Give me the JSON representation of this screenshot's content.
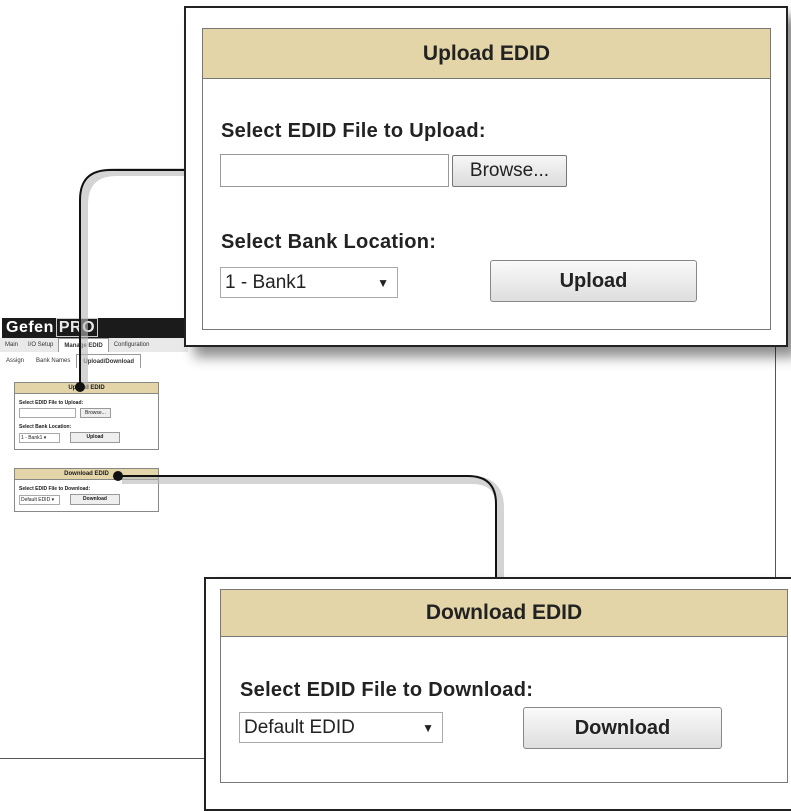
{
  "app": {
    "brand_prefix": "Gefen",
    "brand_suffix": "PRO"
  },
  "nav": {
    "tabs": [
      "Main",
      "I/O Setup",
      "Manage EDID",
      "Configuration"
    ],
    "active_tab": "Manage EDID",
    "subtabs": [
      "Assign",
      "Bank Names",
      "Upload/Download"
    ],
    "active_subtab": "Upload/Download"
  },
  "upload": {
    "title": "Upload EDID",
    "file_label": "Select EDID File to Upload:",
    "file_value": "",
    "browse_label": "Browse...",
    "bank_label": "Select Bank Location:",
    "bank_selected": "1 - Bank1",
    "upload_label": "Upload"
  },
  "download": {
    "title": "Download EDID",
    "file_label": "Select EDID File to Download:",
    "file_selected": "Default EDID",
    "download_label": "Download"
  },
  "mini": {
    "upload_title": "Upload EDID",
    "upload_file_label": "Select EDID File to Upload:",
    "browse_label": "Browse...",
    "bank_label": "Select Bank Location:",
    "bank_selected": "1 - Bank1",
    "upload_label": "Upload",
    "download_title": "Download EDID",
    "download_file_label": "Select EDID File to Download:",
    "download_selected": "Default EDID",
    "download_label": "Download"
  },
  "colors": {
    "header_tan": "#e3d5a8",
    "brand_bg": "#1b1b1b"
  }
}
